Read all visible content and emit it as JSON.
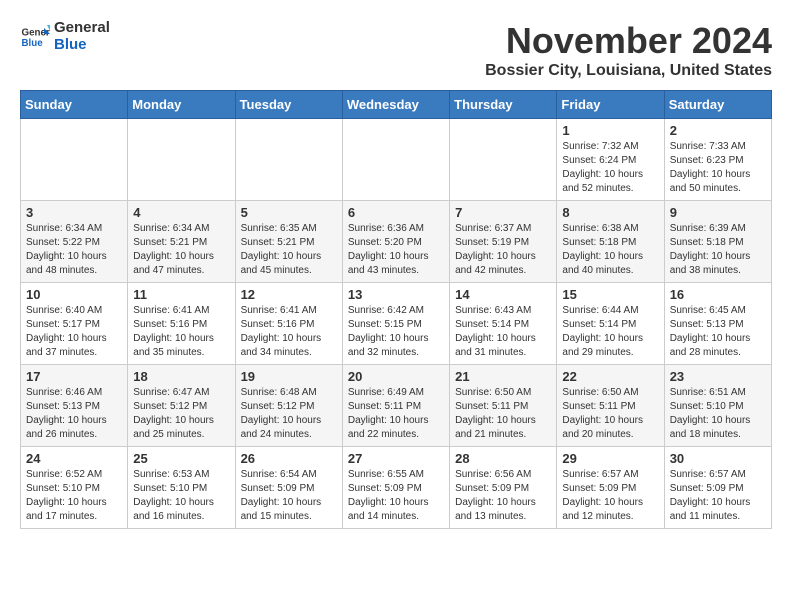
{
  "header": {
    "logo_line1": "General",
    "logo_line2": "Blue",
    "month_title": "November 2024",
    "subtitle": "Bossier City, Louisiana, United States"
  },
  "weekdays": [
    "Sunday",
    "Monday",
    "Tuesday",
    "Wednesday",
    "Thursday",
    "Friday",
    "Saturday"
  ],
  "weeks": [
    [
      {
        "day": "",
        "info": ""
      },
      {
        "day": "",
        "info": ""
      },
      {
        "day": "",
        "info": ""
      },
      {
        "day": "",
        "info": ""
      },
      {
        "day": "",
        "info": ""
      },
      {
        "day": "1",
        "info": "Sunrise: 7:32 AM\nSunset: 6:24 PM\nDaylight: 10 hours\nand 52 minutes."
      },
      {
        "day": "2",
        "info": "Sunrise: 7:33 AM\nSunset: 6:23 PM\nDaylight: 10 hours\nand 50 minutes."
      }
    ],
    [
      {
        "day": "3",
        "info": "Sunrise: 6:34 AM\nSunset: 5:22 PM\nDaylight: 10 hours\nand 48 minutes."
      },
      {
        "day": "4",
        "info": "Sunrise: 6:34 AM\nSunset: 5:21 PM\nDaylight: 10 hours\nand 47 minutes."
      },
      {
        "day": "5",
        "info": "Sunrise: 6:35 AM\nSunset: 5:21 PM\nDaylight: 10 hours\nand 45 minutes."
      },
      {
        "day": "6",
        "info": "Sunrise: 6:36 AM\nSunset: 5:20 PM\nDaylight: 10 hours\nand 43 minutes."
      },
      {
        "day": "7",
        "info": "Sunrise: 6:37 AM\nSunset: 5:19 PM\nDaylight: 10 hours\nand 42 minutes."
      },
      {
        "day": "8",
        "info": "Sunrise: 6:38 AM\nSunset: 5:18 PM\nDaylight: 10 hours\nand 40 minutes."
      },
      {
        "day": "9",
        "info": "Sunrise: 6:39 AM\nSunset: 5:18 PM\nDaylight: 10 hours\nand 38 minutes."
      }
    ],
    [
      {
        "day": "10",
        "info": "Sunrise: 6:40 AM\nSunset: 5:17 PM\nDaylight: 10 hours\nand 37 minutes."
      },
      {
        "day": "11",
        "info": "Sunrise: 6:41 AM\nSunset: 5:16 PM\nDaylight: 10 hours\nand 35 minutes."
      },
      {
        "day": "12",
        "info": "Sunrise: 6:41 AM\nSunset: 5:16 PM\nDaylight: 10 hours\nand 34 minutes."
      },
      {
        "day": "13",
        "info": "Sunrise: 6:42 AM\nSunset: 5:15 PM\nDaylight: 10 hours\nand 32 minutes."
      },
      {
        "day": "14",
        "info": "Sunrise: 6:43 AM\nSunset: 5:14 PM\nDaylight: 10 hours\nand 31 minutes."
      },
      {
        "day": "15",
        "info": "Sunrise: 6:44 AM\nSunset: 5:14 PM\nDaylight: 10 hours\nand 29 minutes."
      },
      {
        "day": "16",
        "info": "Sunrise: 6:45 AM\nSunset: 5:13 PM\nDaylight: 10 hours\nand 28 minutes."
      }
    ],
    [
      {
        "day": "17",
        "info": "Sunrise: 6:46 AM\nSunset: 5:13 PM\nDaylight: 10 hours\nand 26 minutes."
      },
      {
        "day": "18",
        "info": "Sunrise: 6:47 AM\nSunset: 5:12 PM\nDaylight: 10 hours\nand 25 minutes."
      },
      {
        "day": "19",
        "info": "Sunrise: 6:48 AM\nSunset: 5:12 PM\nDaylight: 10 hours\nand 24 minutes."
      },
      {
        "day": "20",
        "info": "Sunrise: 6:49 AM\nSunset: 5:11 PM\nDaylight: 10 hours\nand 22 minutes."
      },
      {
        "day": "21",
        "info": "Sunrise: 6:50 AM\nSunset: 5:11 PM\nDaylight: 10 hours\nand 21 minutes."
      },
      {
        "day": "22",
        "info": "Sunrise: 6:50 AM\nSunset: 5:11 PM\nDaylight: 10 hours\nand 20 minutes."
      },
      {
        "day": "23",
        "info": "Sunrise: 6:51 AM\nSunset: 5:10 PM\nDaylight: 10 hours\nand 18 minutes."
      }
    ],
    [
      {
        "day": "24",
        "info": "Sunrise: 6:52 AM\nSunset: 5:10 PM\nDaylight: 10 hours\nand 17 minutes."
      },
      {
        "day": "25",
        "info": "Sunrise: 6:53 AM\nSunset: 5:10 PM\nDaylight: 10 hours\nand 16 minutes."
      },
      {
        "day": "26",
        "info": "Sunrise: 6:54 AM\nSunset: 5:09 PM\nDaylight: 10 hours\nand 15 minutes."
      },
      {
        "day": "27",
        "info": "Sunrise: 6:55 AM\nSunset: 5:09 PM\nDaylight: 10 hours\nand 14 minutes."
      },
      {
        "day": "28",
        "info": "Sunrise: 6:56 AM\nSunset: 5:09 PM\nDaylight: 10 hours\nand 13 minutes."
      },
      {
        "day": "29",
        "info": "Sunrise: 6:57 AM\nSunset: 5:09 PM\nDaylight: 10 hours\nand 12 minutes."
      },
      {
        "day": "30",
        "info": "Sunrise: 6:57 AM\nSunset: 5:09 PM\nDaylight: 10 hours\nand 11 minutes."
      }
    ]
  ]
}
